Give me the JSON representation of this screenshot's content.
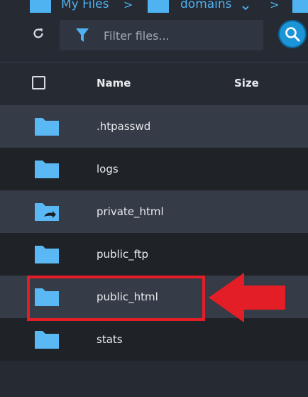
{
  "breadcrumb": {
    "items": [
      {
        "label": "My Files",
        "icon": "folder-icon"
      },
      {
        "label": "domains",
        "icon": "folder-icon",
        "dropdown": true
      },
      {
        "label": "",
        "icon": "folder-icon"
      }
    ],
    "separator": ">"
  },
  "toolbar": {
    "refresh_icon": "refresh-icon",
    "filter_icon": "filter-icon",
    "filter_placeholder": "Filter files...",
    "filter_value": "",
    "search_icon": "search-icon"
  },
  "table": {
    "columns": [
      "Name",
      "Size"
    ],
    "rows": [
      {
        "name": ".htpasswd",
        "icon": "folder-icon"
      },
      {
        "name": "logs",
        "icon": "folder-icon"
      },
      {
        "name": "private_html",
        "icon": "folder-link-icon"
      },
      {
        "name": "public_ftp",
        "icon": "folder-icon"
      },
      {
        "name": "public_html",
        "icon": "folder-icon",
        "highlighted": true
      },
      {
        "name": "stats",
        "icon": "folder-icon"
      }
    ]
  },
  "colors": {
    "background": "#252a33",
    "row_odd": "#353b47",
    "row_even": "#1f2227",
    "accent": "#4fb3f2",
    "highlight": "#e41e26",
    "search_button": "#1b95d8"
  }
}
